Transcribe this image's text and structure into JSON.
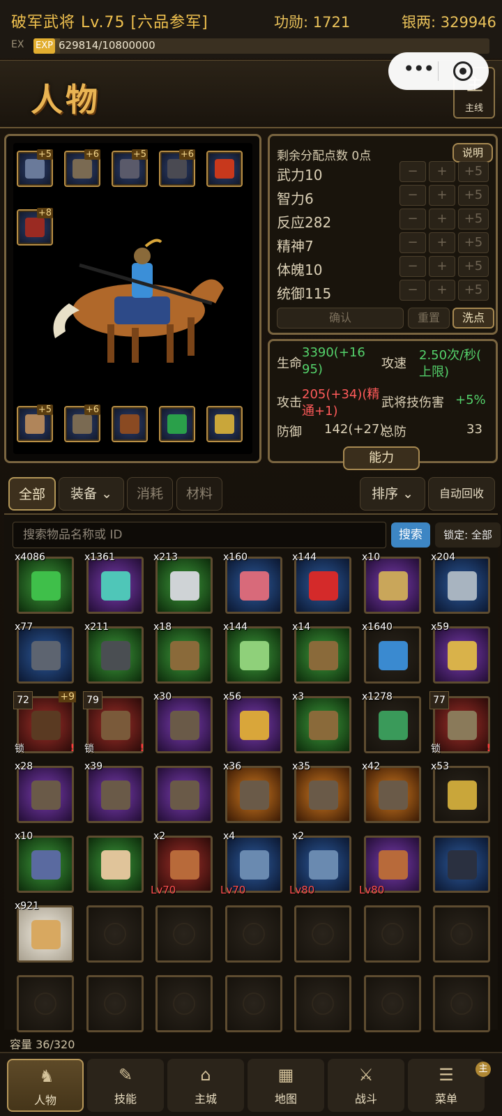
{
  "topbar": {
    "title": "破军武将 Lv.75 [六品参军]",
    "merit": "功勋: 1721",
    "silver": "银两: 329946",
    "ex_label": "EX",
    "exp_tag": "EXP",
    "exp_text": "629814/10800000",
    "exp_fraction": 0.0583
  },
  "capsule": {
    "more": "•••"
  },
  "header": {
    "title": "人物",
    "mainline_label": "主线",
    "mainline_icon": "主"
  },
  "equipment": {
    "top_slots": [
      {
        "icon": "helmet-icon",
        "plus": "+5"
      },
      {
        "icon": "armor-icon",
        "plus": "+6"
      },
      {
        "icon": "boots-icon",
        "plus": "+5"
      },
      {
        "icon": "bracer-icon",
        "plus": "+6"
      },
      {
        "icon": "fire-orb-icon",
        "plus": ""
      }
    ],
    "weapon_slot": {
      "icon": "weapon-icon",
      "plus": "+8"
    },
    "bottom_slots": [
      {
        "icon": "glove-icon",
        "plus": "+5"
      },
      {
        "icon": "gauntlet-icon",
        "plus": "+6"
      },
      {
        "icon": "beast-icon",
        "plus": ""
      },
      {
        "icon": "jade-amulet-icon",
        "plus": ""
      },
      {
        "icon": "gold-emblem-icon",
        "plus": ""
      }
    ]
  },
  "stats": {
    "remaining": "剩余分配点数 0点",
    "explain": "说明",
    "rows": [
      {
        "name": "武力10"
      },
      {
        "name": "智力6"
      },
      {
        "name": "反应282"
      },
      {
        "name": "精神7"
      },
      {
        "name": "体魄10"
      },
      {
        "name": "统御115"
      }
    ],
    "minus": "−",
    "plus": "+",
    "plus5": "+5",
    "confirm": "确认",
    "reset": "重置",
    "wash": "洗点"
  },
  "attributes": {
    "hp_label": "生命",
    "hp_value": "3390(+16",
    "hp_value2": "95)",
    "speed_label": "攻速",
    "speed_value": "2.50次/秒(",
    "speed_value2": "上限)",
    "atk_label": "攻击",
    "atk_value": "205(+34)(精",
    "atk_value2": "通+1)",
    "skill_label": "武将技伤害",
    "skill_value": "+5%",
    "def_label": "防御",
    "def_value": "142(+27)",
    "total_def_label": "总防",
    "total_def_value": "33",
    "ability": "能力"
  },
  "tabs": {
    "all": "全部",
    "equip": "装备",
    "consume": "消耗",
    "material": "材料",
    "sort": "排序",
    "auto_recycle": "自动回收"
  },
  "search": {
    "placeholder": "搜索物品名称或 ID",
    "button": "搜索",
    "lock": "锁定: 全部"
  },
  "items": [
    {
      "cnt": "x4086",
      "bg": "g",
      "color": "#3fbf4a"
    },
    {
      "cnt": "x1361",
      "bg": "p",
      "color": "#4fc6b8"
    },
    {
      "cnt": "x213",
      "bg": "g",
      "color": "#cfd3d6"
    },
    {
      "cnt": "x160",
      "bg": "b",
      "color": "#d86a7a"
    },
    {
      "cnt": "x144",
      "bg": "b",
      "color": "#d42a2a"
    },
    {
      "cnt": "x10",
      "bg": "p",
      "color": "#c9a65a"
    },
    {
      "cnt": "x204",
      "bg": "b",
      "color": "#a8b4c0"
    },
    {
      "cnt": "x77",
      "bg": "b",
      "color": "#5d6470"
    },
    {
      "cnt": "x211",
      "bg": "g",
      "color": "#4a4e52"
    },
    {
      "cnt": "x18",
      "bg": "g",
      "color": "#8a6a3a"
    },
    {
      "cnt": "x144",
      "bg": "g",
      "color": "#8fd07a"
    },
    {
      "cnt": "x14",
      "bg": "g",
      "color": "#8a6a3a"
    },
    {
      "cnt": "x1640",
      "bg": "e",
      "color": "#3a8ad0"
    },
    {
      "cnt": "x59",
      "bg": "p",
      "color": "#d9b24a"
    },
    {
      "cnt": "",
      "tl": "72",
      "pl": "+9",
      "lock": "锁",
      "ex": "!",
      "bg": "r",
      "color": "#5a3a22"
    },
    {
      "cnt": "",
      "tl": "79",
      "lock": "锁",
      "ex": "!",
      "bg": "r",
      "color": "#7a5a3a"
    },
    {
      "cnt": "x30",
      "bg": "p",
      "color": "#6a5a48"
    },
    {
      "cnt": "x56",
      "bg": "p",
      "color": "#d9a63a"
    },
    {
      "cnt": "x3",
      "bg": "g",
      "color": "#8a6a3a"
    },
    {
      "cnt": "x1278",
      "bg": "e",
      "color": "#3a9a5a"
    },
    {
      "cnt": "",
      "tl": "77",
      "lock": "锁",
      "ex": "!",
      "bg": "r",
      "color": "#8a7a5a"
    },
    {
      "cnt": "x28",
      "bg": "p",
      "color": "#6a5a48"
    },
    {
      "cnt": "x39",
      "bg": "p",
      "color": "#6a5a48"
    },
    {
      "cnt": "",
      "bg": "p",
      "color": "#6a5a48"
    },
    {
      "cnt": "x36",
      "bg": "o",
      "color": "#6a5a48"
    },
    {
      "cnt": "x35",
      "bg": "o",
      "color": "#6a5a48"
    },
    {
      "cnt": "x42",
      "bg": "o",
      "color": "#6a5a48"
    },
    {
      "cnt": "x53",
      "bg": "e",
      "color": "#c9a63a"
    },
    {
      "cnt": "x10",
      "bg": "g",
      "color": "#5a6aa0"
    },
    {
      "cnt": "",
      "bg": "g",
      "color": "#e0c49a"
    },
    {
      "cnt": "x2",
      "lv": "Lv70",
      "bg": "r",
      "color": "#b86a3a"
    },
    {
      "cnt": "x4",
      "lv": "Lv70",
      "bg": "b",
      "color": "#6a8ab0"
    },
    {
      "cnt": "x2",
      "lv": "Lv80",
      "bg": "b",
      "color": "#6a8ab0"
    },
    {
      "cnt": "",
      "lv": "Lv80",
      "bg": "p",
      "color": "#b86a3a"
    },
    {
      "cnt": "",
      "bg": "b",
      "color": "#2a3040"
    },
    {
      "cnt": "x921",
      "bg": "w",
      "color": "#d8a860"
    }
  ],
  "capacity": "容量 36/320",
  "nav": [
    {
      "label": "人物",
      "icon": "♞",
      "name": "character"
    },
    {
      "label": "技能",
      "icon": "✎",
      "name": "skills"
    },
    {
      "label": "主城",
      "icon": "⌂",
      "name": "main-city"
    },
    {
      "label": "地图",
      "icon": "▦",
      "name": "map"
    },
    {
      "label": "战斗",
      "icon": "⚔",
      "name": "battle"
    },
    {
      "label": "菜单",
      "icon": "☰",
      "name": "menu"
    }
  ],
  "menu_badge": "主",
  "colors": {
    "accent": "#f1c24f",
    "search_button": "#3d86c4",
    "green_text": "#54d26b",
    "red_text": "#ff5a5a"
  }
}
